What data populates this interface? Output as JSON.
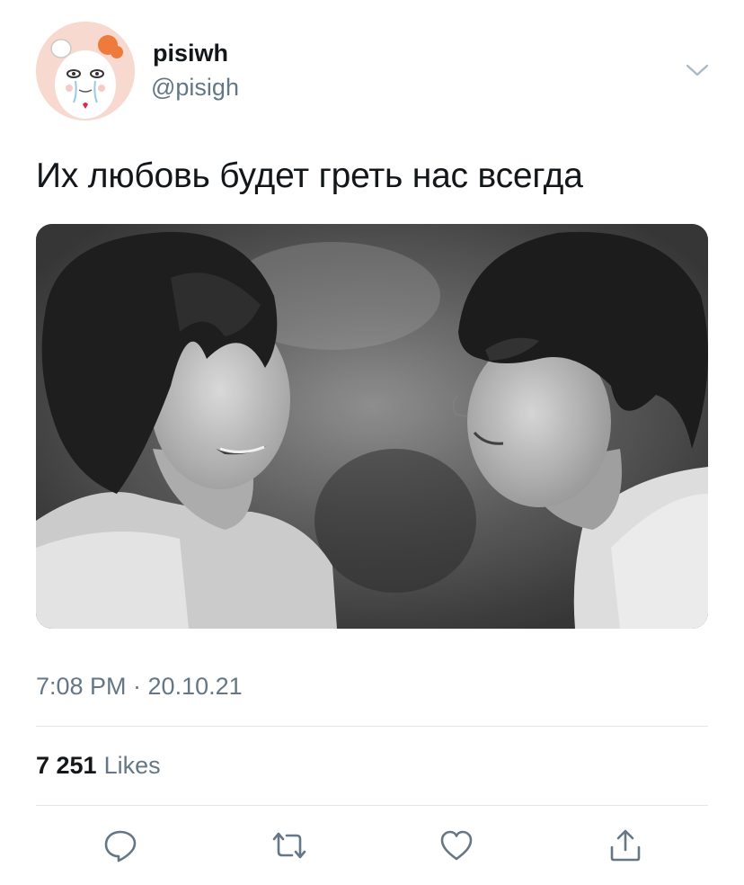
{
  "tweet": {
    "author": {
      "display_name": "pisiwh",
      "handle": "@pisigh",
      "avatar_icon": "cartoon-hamster-avatar"
    },
    "text": "Их любовь будет греть нас всегда",
    "media": {
      "type": "photo",
      "style": "black-and-white"
    },
    "timestamp": "7:08 PM · 20.10.21",
    "stats": {
      "likes_count": "7 251",
      "likes_label": "Likes"
    },
    "actions": {
      "reply_icon": "speech-bubble-icon",
      "retweet_icon": "retweet-arrows-icon",
      "like_icon": "heart-icon",
      "share_icon": "share-upload-icon"
    }
  },
  "colors": {
    "primary_text": "#14171a",
    "secondary_text": "#657786",
    "divider": "#e1e8ed",
    "icon": "#657786"
  }
}
